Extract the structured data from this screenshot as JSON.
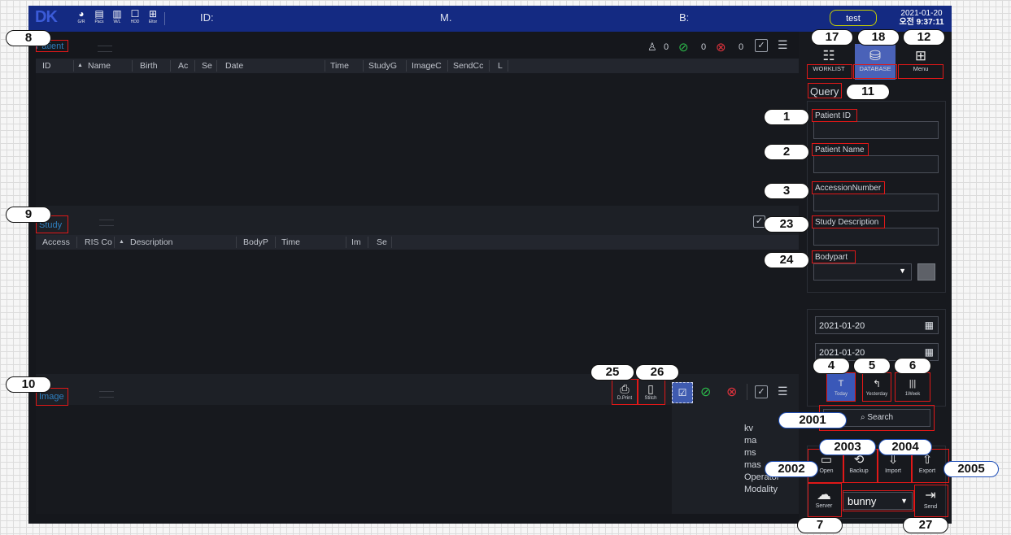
{
  "topbar": {
    "logo": "DK",
    "icons": [
      {
        "glyph": "◕",
        "label": "G/R",
        "icon": "gr-icon"
      },
      {
        "glyph": "▤",
        "label": "Pacs",
        "icon": "pacs-icon"
      },
      {
        "glyph": "▥",
        "label": "W/L",
        "icon": "wl-icon"
      },
      {
        "glyph": "☐",
        "label": "HDD",
        "icon": "hdd-icon"
      },
      {
        "glyph": "⊞",
        "label": "Eltor",
        "icon": "editor-icon"
      }
    ],
    "id_label": "ID:",
    "m_label": "M.",
    "b_label": "B:",
    "user": "test",
    "date": "2021-01-20",
    "time": "오전 9:37:11"
  },
  "patient": {
    "title": "Patient",
    "counts": {
      "users": "0",
      "ok": "0",
      "error": "0"
    },
    "columns": [
      "ID",
      "Name",
      "Birth",
      "Ac",
      "Se",
      "Date",
      "Time",
      "StudyG",
      "ImageC",
      "SendCc",
      "L"
    ]
  },
  "study": {
    "title": "Study",
    "columns": [
      "Access",
      "RIS Co",
      "Description",
      "BodyP",
      "Time",
      "Im",
      "Se"
    ]
  },
  "image": {
    "title": "Image",
    "dprint": "D.Print",
    "stitch": "Stitch",
    "info": [
      "kv",
      "ma",
      "ms",
      "mas",
      "Operator",
      "Modality"
    ]
  },
  "right_panel": {
    "tabs": [
      {
        "label": "WORKLIST",
        "icon": "worklist-icon"
      },
      {
        "label": "DATABASE",
        "icon": "database-icon"
      },
      {
        "label": "Menu",
        "icon": "menu-grid-icon"
      }
    ],
    "query_title": "Query",
    "fields": {
      "patient_id": {
        "label": "Patient ID",
        "value": ""
      },
      "patient_name": {
        "label": "Patient Name",
        "value": ""
      },
      "accession": {
        "label": "AccessionNumber",
        "value": ""
      },
      "study_desc": {
        "label": "Study Description",
        "value": ""
      },
      "bodypart": {
        "label": "Bodypart",
        "value": ""
      }
    },
    "date_from": "2021-01-20",
    "date_to": "2021-01-20",
    "quick": [
      {
        "label": "Today",
        "glyph": "T"
      },
      {
        "label": "Yesterday",
        "glyph": "↰"
      },
      {
        "label": "1Week",
        "glyph": "|||"
      }
    ],
    "search": "Search",
    "actions": [
      {
        "label": "Open",
        "glyph": "▭"
      },
      {
        "label": "Backup",
        "glyph": "⟲"
      },
      {
        "label": "Import",
        "glyph": "⇩"
      },
      {
        "label": "Export",
        "glyph": "⇧"
      }
    ],
    "server": "Server",
    "server_value": "bunny",
    "send": "Send"
  },
  "callouts": [
    "8",
    "9",
    "10",
    "17",
    "18",
    "12",
    "11",
    "1",
    "2",
    "3",
    "23",
    "24",
    "4",
    "5",
    "6",
    "25",
    "26",
    "2001",
    "2002",
    "2003",
    "2004",
    "2005",
    "7",
    "27"
  ]
}
